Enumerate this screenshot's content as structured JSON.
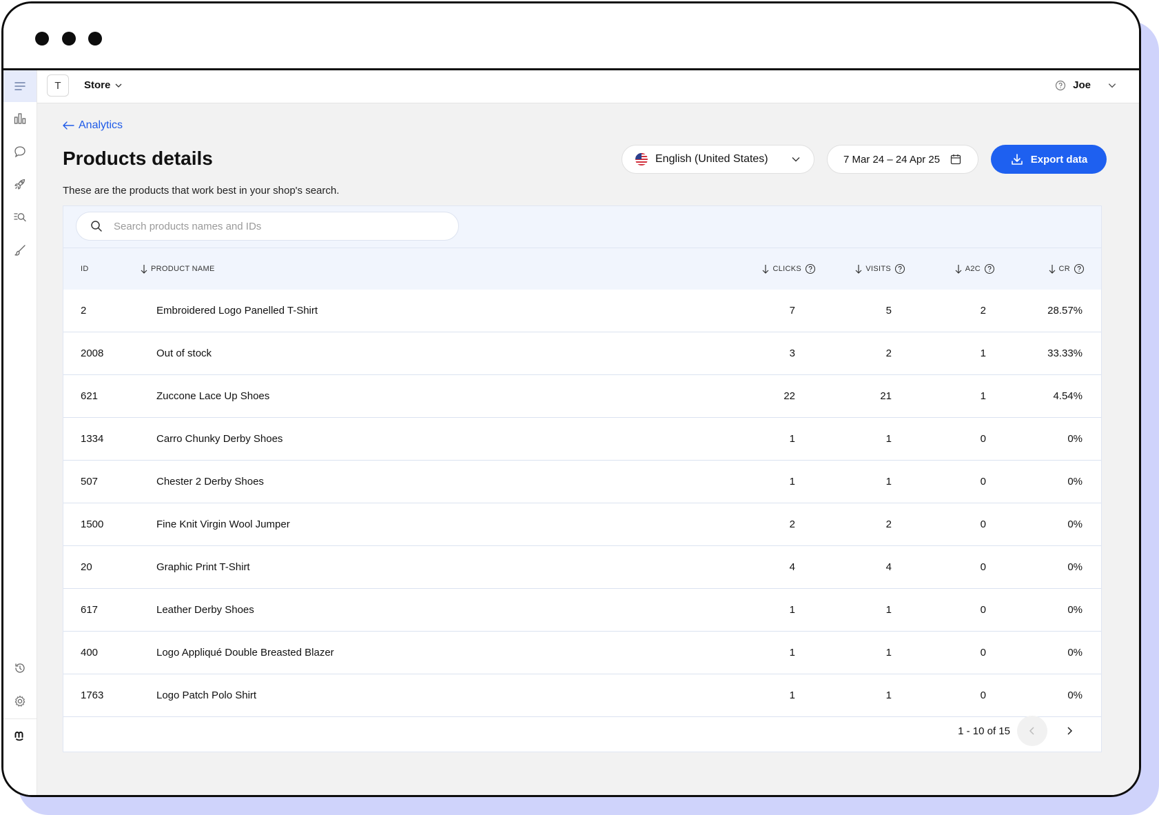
{
  "topbar": {
    "store_badge": "T",
    "store_name": "Store",
    "user_name": "Joe"
  },
  "nav": {
    "back_label": "Analytics"
  },
  "page": {
    "title": "Products details",
    "subtitle": "These are the products that work best in your shop's search."
  },
  "filters": {
    "language": "English (United States)",
    "date_range": "7 Mar 24 – 24 Apr 25",
    "export_label": "Export data"
  },
  "search": {
    "placeholder": "Search products names and IDs"
  },
  "table": {
    "columns": {
      "id": "ID",
      "name": "PRODUCT NAME",
      "clicks": "CLICKS",
      "visits": "VISITS",
      "a2c": "A2C",
      "cr": "CR"
    },
    "rows": [
      {
        "id": "2",
        "name": "Embroidered Logo Panelled T-Shirt",
        "clicks": "7",
        "visits": "5",
        "a2c": "2",
        "cr": "28.57%"
      },
      {
        "id": "2008",
        "name": "Out of stock",
        "clicks": "3",
        "visits": "2",
        "a2c": "1",
        "cr": "33.33%"
      },
      {
        "id": "621",
        "name": "Zuccone Lace Up Shoes",
        "clicks": "22",
        "visits": "21",
        "a2c": "1",
        "cr": "4.54%"
      },
      {
        "id": "1334",
        "name": "Carro Chunky Derby Shoes",
        "clicks": "1",
        "visits": "1",
        "a2c": "0",
        "cr": "0%"
      },
      {
        "id": "507",
        "name": "Chester 2 Derby Shoes",
        "clicks": "1",
        "visits": "1",
        "a2c": "0",
        "cr": "0%"
      },
      {
        "id": "1500",
        "name": "Fine Knit Virgin Wool Jumper",
        "clicks": "2",
        "visits": "2",
        "a2c": "0",
        "cr": "0%"
      },
      {
        "id": "20",
        "name": "Graphic Print T-Shirt",
        "clicks": "4",
        "visits": "4",
        "a2c": "0",
        "cr": "0%"
      },
      {
        "id": "617",
        "name": "Leather Derby Shoes",
        "clicks": "1",
        "visits": "1",
        "a2c": "0",
        "cr": "0%"
      },
      {
        "id": "400",
        "name": "Logo Appliqué Double Breasted Blazer",
        "clicks": "1",
        "visits": "1",
        "a2c": "0",
        "cr": "0%"
      },
      {
        "id": "1763",
        "name": "Logo Patch Polo Shirt",
        "clicks": "1",
        "visits": "1",
        "a2c": "0",
        "cr": "0%"
      }
    ]
  },
  "pagination": {
    "range": "1 - 10 of 15"
  },
  "colors": {
    "accent": "#1e60f0",
    "link": "#1f5be8",
    "header_bg": "#f1f5fd",
    "app_bg": "#f2f2f2",
    "frame_shadow": "#cfd3fb"
  }
}
